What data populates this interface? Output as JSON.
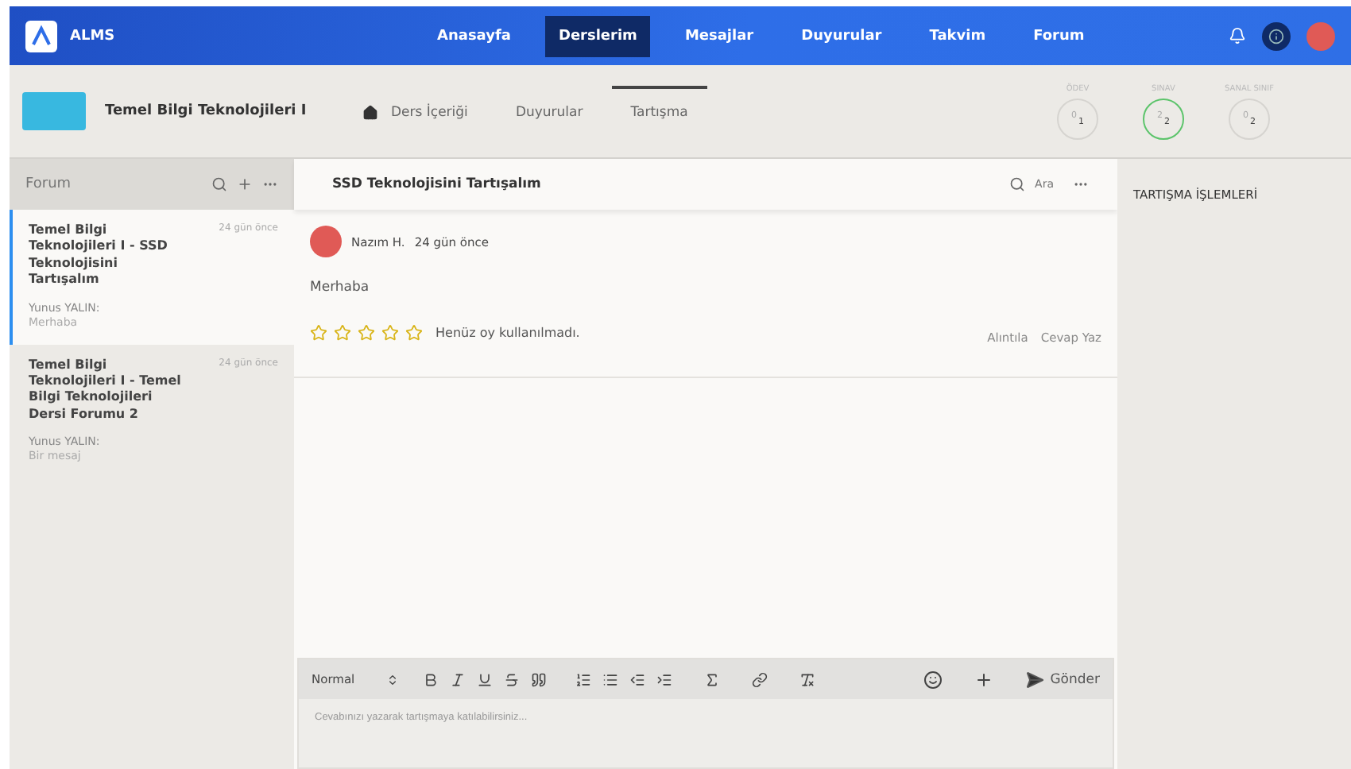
{
  "topbar": {
    "logo_text": "ALMS",
    "nav": [
      {
        "label": "Anasayfa",
        "selected": false
      },
      {
        "label": "Derslerim",
        "selected": true
      },
      {
        "label": "Mesajlar",
        "selected": false
      },
      {
        "label": "Duyurular",
        "selected": false
      },
      {
        "label": "Takvim",
        "selected": false
      },
      {
        "label": "Forum",
        "selected": false
      }
    ]
  },
  "course_header": {
    "title": "Temel Bilgi Teknolojileri I",
    "tabs": [
      {
        "label": "Ders İçeriği",
        "selected": false,
        "home": true
      },
      {
        "label": "Duyurular",
        "selected": false,
        "home": false
      },
      {
        "label": "Tartışma",
        "selected": true,
        "home": false
      }
    ],
    "stats": [
      {
        "label": "ÖDEV",
        "done": "0",
        "total": "1",
        "color": "#d6d4d0"
      },
      {
        "label": "SINAV",
        "done": "2",
        "total": "2",
        "color": "#5cc46b"
      },
      {
        "label": "SANAL SINIF",
        "done": "0",
        "total": "2",
        "color": "#d6d4d0"
      }
    ]
  },
  "forum": {
    "title": "Forum",
    "threads": [
      {
        "title": "Temel Bilgi Teknolojileri I - SSD Teknolojisini Tartışalım",
        "time": "24 gün önce",
        "author": "Yunus YALIN:",
        "preview": "Merhaba",
        "selected": true
      },
      {
        "title": "Temel Bilgi Teknolojileri I - Temel Bilgi Teknolojileri Dersi Forumu 2",
        "time": "24 gün önce",
        "author": "Yunus YALIN:",
        "preview": "Bir mesaj",
        "selected": false
      }
    ]
  },
  "discussion": {
    "title": "SSD Teknolojisini Tartışalım",
    "search_label": "Ara",
    "posts": [
      {
        "author": "Nazım H.",
        "time": "24 gün önce",
        "body": "Merhaba",
        "stars": 0,
        "rating_text": "Henüz oy kullanılmadı.",
        "actions": [
          "Alıntıla",
          "Cevap Yaz"
        ]
      }
    ]
  },
  "editor": {
    "format": "Normal",
    "send": "Gönder",
    "placeholder": "Cevabınızı yazarak tartışmaya katılabilirsiniz..."
  },
  "side_panel": {
    "title": "TARTIŞMA İŞLEMLERİ"
  }
}
